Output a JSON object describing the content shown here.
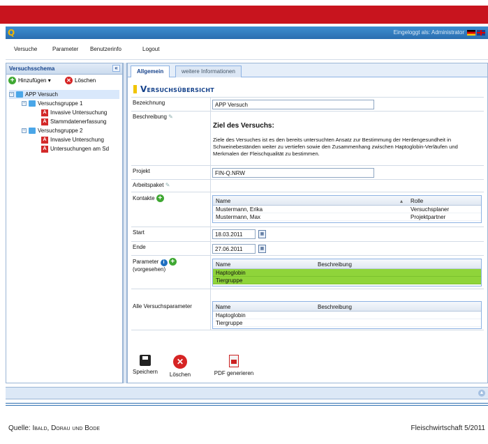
{
  "app": {
    "logo": "Q",
    "user_text": "Eingeloggt als: Administrator",
    "languages": [
      "de",
      "en"
    ]
  },
  "menu": [
    "Versuche",
    "Parameter",
    "Benutzerinfo",
    "Logout"
  ],
  "left_panel": {
    "title": "Versuchsschema",
    "collapse_glyph": "«",
    "add_label": "Hinzufügen ▾",
    "delete_label": "Löschen",
    "tree": [
      {
        "label": "APP Versuch",
        "level": 0,
        "type": "folder",
        "selected": true
      },
      {
        "label": "Versuchsgruppe 1",
        "level": 1,
        "type": "folder"
      },
      {
        "label": "Invasive Untersuchung",
        "level": 2,
        "type": "item"
      },
      {
        "label": "Stammdatenerfassung",
        "level": 2,
        "type": "item"
      },
      {
        "label": "Versuchsgruppe 2",
        "level": 1,
        "type": "folder"
      },
      {
        "label": "Invasive Unterschung",
        "level": 2,
        "type": "item"
      },
      {
        "label": "Untersuchungen am Sd",
        "level": 2,
        "type": "item"
      }
    ]
  },
  "tabs": [
    "Allgemein",
    "weitere Informationen"
  ],
  "section_title": "Versuchsübersicht",
  "form": {
    "bezeichnung_label": "Bezeichnung",
    "bezeichnung_value": "APP Versuch",
    "beschreibung_label": "Beschreibung",
    "beschreibung_heading": "Ziel des Versuchs:",
    "beschreibung_text": "Ziele des Versuches ist es den bereits untersuchten Ansatz zur Bestimmung der Herdengesundheit in Schweinebeständen weiter zu vertiefen sowie den Zusammenhang zwischen Haptoglobin-Verläufen und Merkmalen der Fleischqualität zu bestimmen.",
    "projekt_label": "Projekt",
    "projekt_value": "FIN-Q.NRW",
    "arbeitspaket_label": "Arbeitspaket",
    "kontakte_label": "Kontakte",
    "kontakte_columns": [
      "Name",
      "Rolle"
    ],
    "kontakte_rows": [
      {
        "name": "Mustermann, Erika",
        "rolle": "Versuchsplaner"
      },
      {
        "name": "Mustermann, Max",
        "rolle": "Projektpartner"
      }
    ],
    "start_label": "Start",
    "start_value": "18.03.2011",
    "ende_label": "Ende",
    "ende_value": "27.06.2011",
    "parameter_label": "Parameter",
    "parameter_sublabel": "(vorgesehen)",
    "parameter_columns": [
      "Name",
      "Beschreibung"
    ],
    "parameter_rows": [
      "Haptoglobin",
      "Tiergruppe"
    ],
    "alle_label": "Alle Versuchsparameter",
    "alle_columns": [
      "Name",
      "Beschreibung"
    ],
    "alle_rows": [
      "Haptoglobin",
      "Tiergruppe"
    ]
  },
  "actions": {
    "save": "Speichern",
    "delete": "Löschen",
    "pdf": "PDF generieren"
  },
  "caption": {
    "source_prefix": "Quelle:",
    "source_names": "Ibald, Dorau und Bode",
    "journal": "Fleischwirtschaft 5/2011"
  },
  "colors": {
    "top_bar": "#c8141e",
    "header_blue": "#2a6db0",
    "highlight_green": "#8fd43a",
    "title_blue": "#15428b"
  }
}
